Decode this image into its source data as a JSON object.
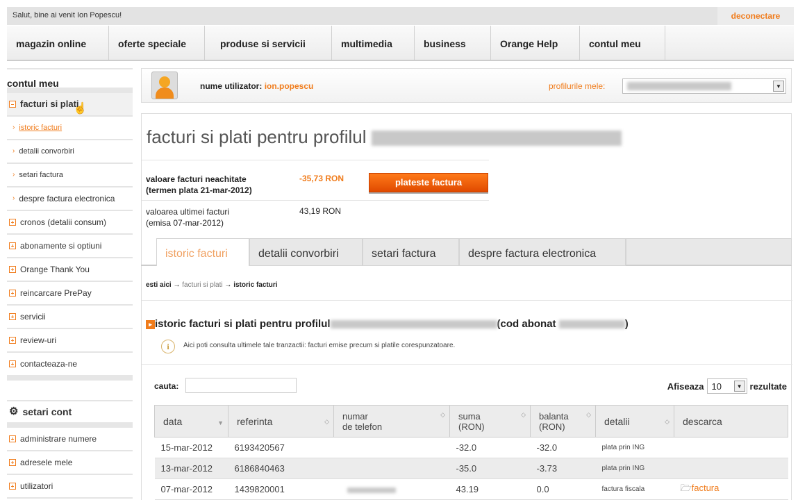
{
  "topbar": {
    "greeting": "Salut, bine ai venit Ion Popescu!",
    "logout": "deconectare"
  },
  "nav": [
    "magazin online",
    "oferte speciale",
    "produse si servicii",
    "multimedia",
    "business",
    "Orange Help",
    "contul meu"
  ],
  "sidebar": {
    "title": "contul meu",
    "active": "facturi si plati",
    "subitems": [
      "istoric facturi",
      "detalii convorbiri",
      "setari factura",
      "despre factura electronica"
    ],
    "items": [
      "cronos (detalii consum)",
      "abonamente si optiuni",
      "Orange Thank You",
      "reincarcare PrePay",
      "servicii",
      "review-uri",
      "contacteaza-ne"
    ],
    "settings_title": "setari cont",
    "settings_items": [
      "administrare numere",
      "adresele mele",
      "utilizatori"
    ]
  },
  "profile": {
    "label": "nume utilizator:",
    "username": "ion.popescu",
    "profiles_label": "profilurile mele:"
  },
  "page": {
    "title": "facturi si plati pentru profilul",
    "unpaid_label1": "valoare facturi neachitate",
    "unpaid_label2": "(termen plata 21-mar-2012)",
    "unpaid_value": "-35,73 RON",
    "pay_button": "plateste factura",
    "last_label1": "valoarea ultimei facturi",
    "last_label2": "(emisa 07-mar-2012)",
    "last_value": "43,19 RON"
  },
  "tabs": [
    "istoric facturi",
    "detalii convorbiri",
    "setari factura",
    "despre factura electronica"
  ],
  "breadcrumb": {
    "here": "esti aici",
    "level1": "facturi si plati",
    "level2": "istoric facturi",
    "sep": "→"
  },
  "section": {
    "title": "istoric facturi si plati pentru profilul",
    "code": "(cod abonat",
    "close": ")",
    "info": "Aici poti consulta ultimele tale tranzactii: facturi emise precum si platile corespunzatoare."
  },
  "search": {
    "label": "cauta:",
    "value": ""
  },
  "pager": {
    "show": "Afiseaza",
    "count": "10",
    "results": "rezultate"
  },
  "table": {
    "headers": [
      "data",
      "referinta",
      "numar\nde telefon",
      "suma\n(RON)",
      "balanta\n(RON)",
      "detalii",
      "descarca"
    ],
    "rows": [
      [
        "15-mar-2012",
        "6193420567",
        "",
        "-32.0",
        "-32.0",
        "plata prin ING",
        ""
      ],
      [
        "13-mar-2012",
        "6186840463",
        "",
        "-35.0",
        "-3.73",
        "plata prin ING",
        ""
      ],
      [
        "07-mar-2012",
        "1439820001",
        "",
        "43.19",
        "0.0",
        "factura fiscala",
        "factura"
      ]
    ]
  }
}
